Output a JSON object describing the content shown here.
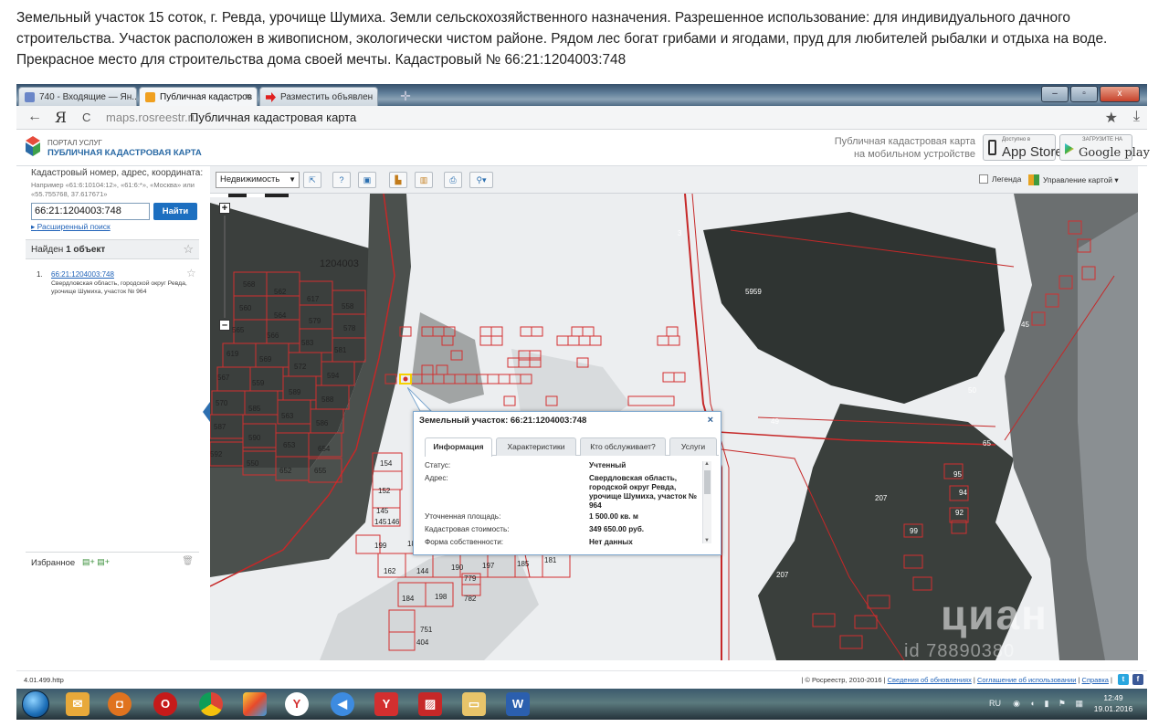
{
  "listing_text": "Земельный участок 15 соток, г. Ревда, урочище Шумиха. Земли сельскохозяйственного назначения. Разрешенное использование: для индивидуального дачного строительства. Участок расположен в живописном, экологически чистом районе. Рядом лес богат грибами и ягодами, пруд для любителей рыбалки и отдыха на воде. Прекрасное место для строительства дома своей мечты. Кадастровый № 66:21:1204003:748",
  "browser": {
    "tabs": [
      {
        "label": "740 - Входящие — Ян...",
        "icon_color": "#6a86c8"
      },
      {
        "label": "Публичная кадастров",
        "icon_color": "#f0a020"
      },
      {
        "label": "Разместить объявлен",
        "icon_color": "#e02020"
      }
    ],
    "back_glyph": "←",
    "yandex_glyph": "Я",
    "reload_glyph": "C",
    "url": "maps.rosreestr.ru",
    "page_title": "Публичная кадастровая карта",
    "minimize": "–",
    "maximize": "▫",
    "close": "x"
  },
  "portal": {
    "line1": "ПОРТАЛ УСЛУГ",
    "line2": "ПУБЛИЧНАЯ КАДАСТРОВАЯ КАРТА",
    "mobile_line1": "Публичная кадастровая карта",
    "mobile_line2": "на мобильном устройстве",
    "appstore_small": "Доступно в",
    "appstore": "App Store",
    "gplay_small": "ЗАГРУЗИТЕ НА",
    "gplay": "Google play"
  },
  "sidebar": {
    "hint_title": "Кадастровый номер, адрес, координата:",
    "hint_examples": "Например «61:6:10104:12», «61:6:*», «Москва» или «55.755768, 37.617671»",
    "search_value": "66:21:1204003:748",
    "find_button": "Найти",
    "advanced_search": "Расширенный поиск",
    "found_prefix": "Найден ",
    "found_count": "1 объект",
    "results": [
      {
        "num": "1.",
        "id": "66:21:1204003:748",
        "address": "Свердловская область, городской округ Ревда, урочище Шумиха, участок № 964"
      }
    ],
    "favorites": "Избранное"
  },
  "toolbar": {
    "layer_select": "Недвижимость",
    "legend": "Легенда",
    "map_control": "Управление картой"
  },
  "map": {
    "quarter_label": "1204003",
    "plot_labels": [
      "568",
      "562",
      "617",
      "558",
      "560",
      "564",
      "579",
      "578",
      "565",
      "566",
      "583",
      "581",
      "619",
      "569",
      "572",
      "594",
      "567",
      "559",
      "589",
      "588",
      "570",
      "585",
      "563",
      "586",
      "587",
      "590",
      "653",
      "654",
      "592",
      "550",
      "652",
      "655",
      "154",
      "152",
      "145",
      "145",
      "146",
      "199",
      "18",
      "162",
      "144",
      "190",
      "197",
      "185",
      "181",
      "184",
      "198",
      "779",
      "782",
      "751",
      "404"
    ],
    "right_labels": [
      "5959",
      "49",
      "45",
      "50",
      "65",
      "207",
      "207",
      "92",
      "94",
      "95",
      "99",
      "3"
    ],
    "watermark": "циан",
    "watermark_id": "id 78890380"
  },
  "popup": {
    "title": "Земельный участок: 66:21:1204003:748",
    "close": "×",
    "tabs": [
      "Информация",
      "Характеристики",
      "Кто обслуживает?",
      "Услуги"
    ],
    "rows": [
      {
        "label": "Статус:",
        "value": "Учтенный"
      },
      {
        "label": "Адрес:",
        "value": "Свердловская область, городской округ Ревда, урочище Шумиха, участок № 964"
      },
      {
        "label": "Уточненная площадь:",
        "value": "1 500.00 кв. м"
      },
      {
        "label": "Кадастровая стоимость:",
        "value": "349 650.00 руб."
      },
      {
        "label": "Форма собственности:",
        "value": "Нет данных"
      }
    ]
  },
  "footer": {
    "version": "4.01.499.http",
    "copyright": "| © Росреестр, 2010-2016 |",
    "link1": "Сведения об обновлениях",
    "link2": "Соглашение об использовании",
    "link3": "Справка"
  },
  "taskbar": {
    "lang": "RU",
    "time": "12:49",
    "date": "19.01.2016"
  }
}
